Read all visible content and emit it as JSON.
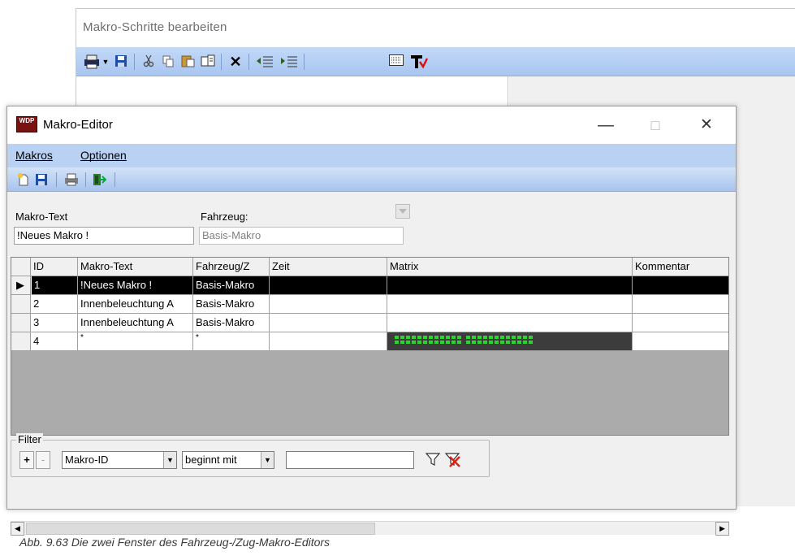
{
  "background_window": {
    "title": "Makro-Schritte bearbeiten",
    "toolbar_icons": [
      "print-icon",
      "dropdown-arrow-icon",
      "save-icon",
      "cut-icon",
      "copy-icon",
      "paste-icon",
      "paste-special-icon",
      "delete-icon",
      "indent-left-icon",
      "indent-right-icon",
      "matrix-icon",
      "text-cursor-icon"
    ]
  },
  "window": {
    "title": "Makro-Editor",
    "app_icon_text": "WDP",
    "controls": {
      "minimize": "—",
      "maximize": "□",
      "close": "✕"
    }
  },
  "menu": {
    "items": [
      {
        "label": "Makros",
        "accel": "M"
      },
      {
        "label": "Optionen",
        "accel": "O"
      }
    ]
  },
  "toolbar": {
    "icons": [
      "new-icon",
      "save-icon",
      "print-icon",
      "exit-icon"
    ]
  },
  "fields": {
    "makro_text_label": "Makro-Text",
    "makro_text_value": "!Neues Makro !",
    "fahrzeug_label": "Fahrzeug:",
    "fahrzeug_value": "Basis-Makro"
  },
  "grid": {
    "columns": [
      "ID",
      "Makro-Text",
      "Fahrzeug/Z",
      "Zeit",
      "Matrix",
      "Kommentar"
    ],
    "rows": [
      {
        "id": "1",
        "makro_text": "!Neues Makro !",
        "fahrzeug": "Basis-Makro",
        "zeit": "",
        "matrix": "",
        "kommentar": "",
        "selected": true,
        "indicator": "▶"
      },
      {
        "id": "2",
        "makro_text": "Innenbeleuchtung A",
        "fahrzeug": "Basis-Makro",
        "zeit": "",
        "matrix": "",
        "kommentar": "",
        "selected": false,
        "indicator": ""
      },
      {
        "id": "3",
        "makro_text": "Innenbeleuchtung A",
        "fahrzeug": "Basis-Makro",
        "zeit": "",
        "matrix": "",
        "kommentar": "",
        "selected": false,
        "indicator": ""
      },
      {
        "id": "4",
        "makro_text": "*",
        "fahrzeug": "*",
        "zeit": "",
        "matrix": "",
        "kommentar": "",
        "selected": false,
        "indicator": ""
      }
    ],
    "matrix_led_color": "#29d629",
    "matrix_bg_color": "#3c3c3c"
  },
  "filter": {
    "legend": "Filter",
    "add_label": "+",
    "remove_label": "-",
    "field_select": "Makro-ID",
    "operator_select": "beginnt mit",
    "value": ""
  },
  "caption": "Abb. 9.63    Die zwei Fenster des Fahrzeug-/Zug-Makro-Editors"
}
